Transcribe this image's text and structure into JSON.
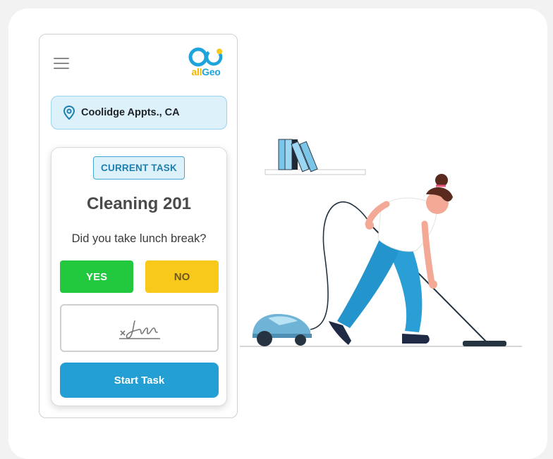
{
  "app": {
    "logo_text": "allGeo",
    "brand_colors": {
      "blue": "#1ea4dc",
      "yellow": "#f8c91a"
    }
  },
  "location": {
    "icon": "location-pin-icon",
    "text": "Coolidge Appts., CA"
  },
  "task": {
    "badge": "CURRENT TASK",
    "title": "Cleaning 201",
    "question": "Did you take lunch break?",
    "yes_label": "YES",
    "no_label": "NO",
    "signature_icon": "signature-icon",
    "start_label": "Start Task"
  },
  "colors": {
    "yes": "#22c93f",
    "no": "#f8c91a",
    "start": "#239fd4",
    "location_bg": "#ddf1fb"
  },
  "illustration": {
    "subject": "woman-vacuuming-illustration"
  }
}
